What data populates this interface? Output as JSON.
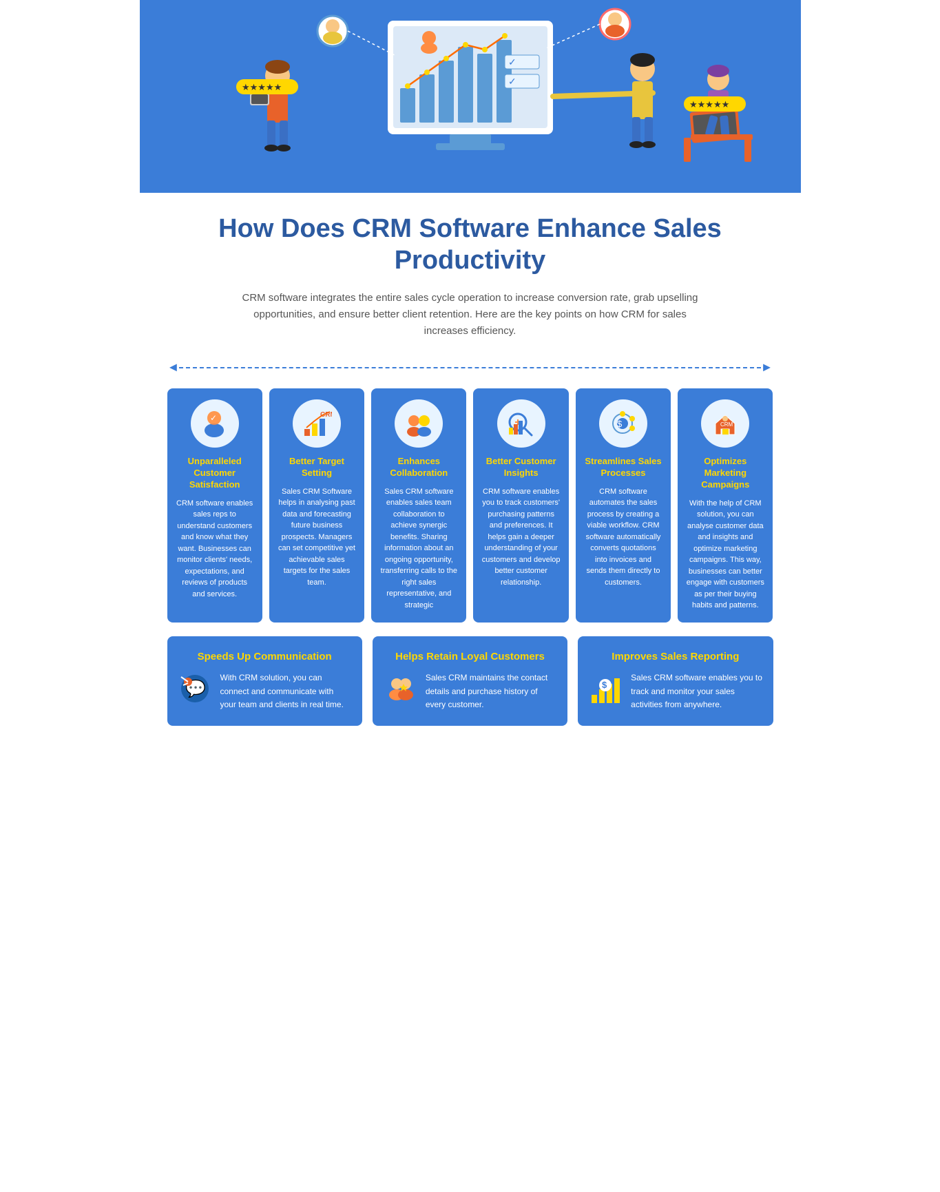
{
  "hero": {
    "background_color": "#3b7dd8"
  },
  "title": {
    "main": "How Does CRM Software Enhance Sales Productivity",
    "subtitle": "CRM software integrates the entire sales cycle operation to increase conversion rate, grab upselling opportunities, and ensure better client retention. Here are the key points on how CRM for sales increases efficiency."
  },
  "top_cards": [
    {
      "id": "card-1",
      "title": "Unparalleled Customer Satisfaction",
      "text": "CRM software enables sales reps to understand customers and know what they want. Businesses can monitor clients' needs, expectations, and reviews of products and services.",
      "icon": "👤✓",
      "icon_color": "#e8f4ff"
    },
    {
      "id": "card-2",
      "title": "Better Target Setting",
      "text": "Sales CRM Software helps in analysing past data and forecasting future business prospects. Managers can set competitive yet achievable sales targets for the sales team.",
      "icon": "📊",
      "icon_color": "#e8f4ff"
    },
    {
      "id": "card-3",
      "title": "Enhances Collaboration",
      "text": "Sales CRM software enables sales team collaboration to achieve synergic benefits. Sharing information about an ongoing opportunity, transferring calls to the right sales representative, and strategic",
      "icon": "🤝",
      "icon_color": "#e8f4ff"
    },
    {
      "id": "card-4",
      "title": "Better Customer Insights",
      "text": "CRM software enables you to track customers' purchasing patterns and preferences. It helps gain a deeper understanding of your customers and develop better customer relationship.",
      "icon": "🔍",
      "icon_color": "#e8f4ff"
    },
    {
      "id": "card-5",
      "title": "Streamlines Sales Processes",
      "text": "CRM software automates the sales process by creating a viable workflow. CRM software automatically converts quotations into invoices and sends them directly to customers.",
      "icon": "⚙️",
      "icon_color": "#e8f4ff"
    },
    {
      "id": "card-6",
      "title": "Optimizes Marketing Campaigns",
      "text": "With the help of CRM solution, you can analyse customer data and insights and optimize marketing campaigns. This way, businesses can better engage with customers as per their buying habits and patterns.",
      "icon": "📢",
      "icon_color": "#e8f4ff"
    }
  ],
  "bottom_cards": [
    {
      "id": "bottom-card-1",
      "title": "Speeds Up Communication",
      "text": "With CRM solution, you can connect and communicate with your team and clients in real time.",
      "icon": "💬"
    },
    {
      "id": "bottom-card-2",
      "title": "Helps Retain Loyal Customers",
      "text": "Sales CRM maintains the contact details and purchase history of every customer.",
      "icon": "👥"
    },
    {
      "id": "bottom-card-3",
      "title": "Improves Sales Reporting",
      "text": "Sales CRM software enables you to track and monitor your sales activities from anywhere.",
      "icon": "💲"
    }
  ],
  "stars": "★★★★★",
  "arrow_left": "◄",
  "arrow_right": "►"
}
